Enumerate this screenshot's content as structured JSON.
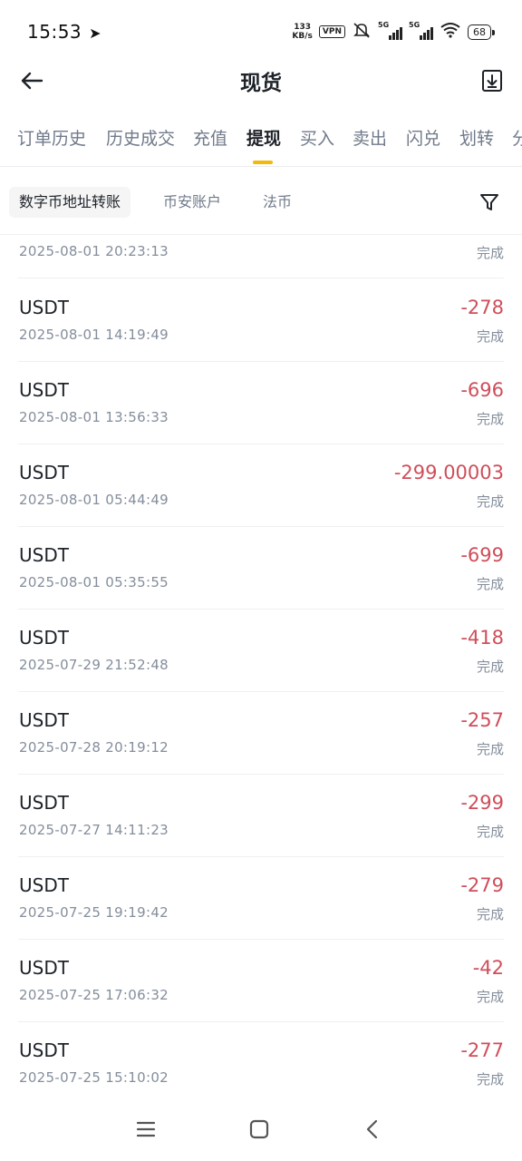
{
  "status_bar": {
    "time": "15:53",
    "net_speed_value": "133",
    "net_speed_unit": "KB/s",
    "vpn": "VPN",
    "signal_1": "5G",
    "signal_2": "5G",
    "battery": "68"
  },
  "header": {
    "title": "现货"
  },
  "tabs": [
    {
      "label": "订单历史"
    },
    {
      "label": "历史成交"
    },
    {
      "label": "充值"
    },
    {
      "label": "提现"
    },
    {
      "label": "买入"
    },
    {
      "label": "卖出"
    },
    {
      "label": "闪兑"
    },
    {
      "label": "划转"
    },
    {
      "label": "分"
    }
  ],
  "active_tab": "提现",
  "subtabs": [
    {
      "label": "数字币地址转账"
    },
    {
      "label": "币安账户"
    },
    {
      "label": "法币"
    }
  ],
  "records": [
    {
      "coin": "",
      "amount": "",
      "time": "2025-08-01 20:23:13",
      "status": "完成"
    },
    {
      "coin": "USDT",
      "amount": "-278",
      "time": "2025-08-01 14:19:49",
      "status": "完成"
    },
    {
      "coin": "USDT",
      "amount": "-696",
      "time": "2025-08-01 13:56:33",
      "status": "完成"
    },
    {
      "coin": "USDT",
      "amount": "-299.00003",
      "time": "2025-08-01 05:44:49",
      "status": "完成"
    },
    {
      "coin": "USDT",
      "amount": "-699",
      "time": "2025-08-01 05:35:55",
      "status": "完成"
    },
    {
      "coin": "USDT",
      "amount": "-418",
      "time": "2025-07-29 21:52:48",
      "status": "完成"
    },
    {
      "coin": "USDT",
      "amount": "-257",
      "time": "2025-07-28 20:19:12",
      "status": "完成"
    },
    {
      "coin": "USDT",
      "amount": "-299",
      "time": "2025-07-27 14:11:23",
      "status": "完成"
    },
    {
      "coin": "USDT",
      "amount": "-279",
      "time": "2025-07-25 19:19:42",
      "status": "完成"
    },
    {
      "coin": "USDT",
      "amount": "-42",
      "time": "2025-07-25 17:06:32",
      "status": "完成"
    },
    {
      "coin": "USDT",
      "amount": "-277",
      "time": "2025-07-25 15:10:02",
      "status": "完成"
    }
  ],
  "colors": {
    "accent": "#f0b90b",
    "negative_amount": "#cf4e5a",
    "secondary_text": "#848e9c"
  },
  "icons": {
    "back": "arrow-left-icon",
    "export": "download-icon",
    "filter": "filter-icon",
    "nav_menu": "menu-icon",
    "nav_home": "home-square-icon",
    "nav_back": "chevron-left-icon"
  }
}
